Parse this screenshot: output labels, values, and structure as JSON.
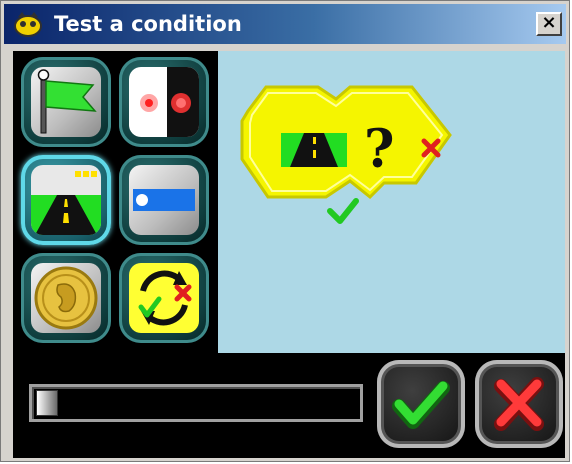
{
  "window": {
    "title": "Test a condition",
    "close_label": "×"
  },
  "tools": [
    {
      "name": "tool-flag",
      "icon": "green-flag-icon",
      "selected": false
    },
    {
      "name": "tool-traffic-light",
      "icon": "red-light-icon",
      "selected": false
    },
    {
      "name": "tool-road",
      "icon": "road-icon",
      "selected": true
    },
    {
      "name": "tool-blue-bar",
      "icon": "blue-bar-icon",
      "selected": false
    },
    {
      "name": "tool-coin",
      "icon": "coin-icon",
      "selected": false
    },
    {
      "name": "tool-yes-no",
      "icon": "yes-no-cycle-icon",
      "selected": false
    }
  ],
  "preview": {
    "question_mark": "?",
    "condition_icon": "road-icon",
    "yes_icon": "check-icon",
    "no_icon": "x-icon"
  },
  "slider": {
    "value": 0
  },
  "buttons": {
    "ok_icon": "check-icon",
    "cancel_icon": "x-icon"
  },
  "colors": {
    "preview_background": "#add8e6",
    "condition_block": "#f5f500",
    "accent_green": "#22c922",
    "accent_red": "#e02020"
  }
}
